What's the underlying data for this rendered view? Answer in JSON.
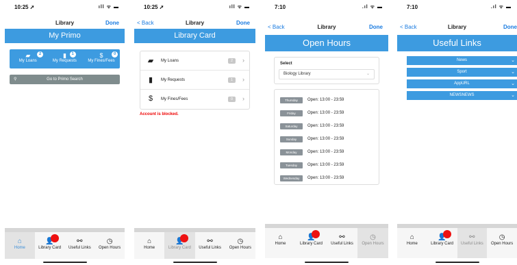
{
  "screens": [
    {
      "status": {
        "time": "10:25 ➚",
        "signal": "ıll ᯤ ▬"
      },
      "nav": {
        "back": "",
        "title": "Library",
        "done": "Done"
      },
      "banner": "My Primo",
      "summary": [
        {
          "icon": "book-icon",
          "glyph": "▰",
          "label": "My Loans",
          "count": "2"
        },
        {
          "icon": "bookmark-icon",
          "glyph": "▮",
          "label": "My Requests",
          "count": "1"
        },
        {
          "icon": "dollar-icon",
          "glyph": "$",
          "label": "My Fines/Fees",
          "count": "0"
        }
      ],
      "search": {
        "icon": "search-icon",
        "glyph": "⚲",
        "label": "Go to Primo Search"
      },
      "tabs": [
        {
          "icon": "home-icon",
          "glyph": "⌂",
          "label": "Home"
        },
        {
          "icon": "user-icon",
          "glyph": "👤",
          "label": "Library Card"
        },
        {
          "icon": "link-icon",
          "glyph": "⚯",
          "label": "Useful Links"
        },
        {
          "icon": "clock-icon",
          "glyph": "◷",
          "label": "Open Hours"
        }
      ]
    },
    {
      "status": {
        "time": "10:25 ➚",
        "signal": "ıll ᯤ ▬"
      },
      "nav": {
        "back": "< Back",
        "title": "Library",
        "done": "Done"
      },
      "banner": "Library Card",
      "rows": [
        {
          "icon": "book-icon",
          "glyph": "▰",
          "label": "My Loans",
          "count": "2"
        },
        {
          "icon": "bookmark-icon",
          "glyph": "▮",
          "label": "My Requests",
          "count": "1"
        },
        {
          "icon": "dollar-icon",
          "glyph": "$",
          "label": "My Fines/Fees",
          "count": "0"
        }
      ],
      "blocked": "Account is blocked.",
      "tabs": [
        {
          "icon": "home-icon",
          "glyph": "⌂",
          "label": "Home"
        },
        {
          "icon": "user-icon",
          "glyph": "👤",
          "label": "Library Card"
        },
        {
          "icon": "link-icon",
          "glyph": "⚯",
          "label": "Useful Links"
        },
        {
          "icon": "clock-icon",
          "glyph": "◷",
          "label": "Open Hours"
        }
      ]
    },
    {
      "status": {
        "time": "7:10",
        "signal": ".ıl ᯤ ▬"
      },
      "nav": {
        "back": "< Back",
        "title": "Library",
        "done": "Done"
      },
      "banner": "Open Hours",
      "select": {
        "label": "Select",
        "value": "Biology Library"
      },
      "hours": [
        {
          "day": "Thursday",
          "time": "Open: 13:00 - 23:59"
        },
        {
          "day": "Friday",
          "time": "Open: 13:00 - 23:59"
        },
        {
          "day": "Saturday",
          "time": "Open: 13:00 - 23:59"
        },
        {
          "day": "Sunday",
          "time": "Open: 13:00 - 23:59"
        },
        {
          "day": "Monday",
          "time": "Open: 13:00 - 23:59"
        },
        {
          "day": "Tuesday",
          "time": "Open: 13:00 - 23:59"
        },
        {
          "day": "Wednesday",
          "time": "Open: 13:00 - 23:59"
        }
      ],
      "tabs": [
        {
          "icon": "home-icon",
          "glyph": "⌂",
          "label": "Home"
        },
        {
          "icon": "user-icon",
          "glyph": "👤",
          "label": "Library Card"
        },
        {
          "icon": "link-icon",
          "glyph": "⚯",
          "label": "Useful Links"
        },
        {
          "icon": "clock-icon",
          "glyph": "◷",
          "label": "Open Hours"
        }
      ]
    },
    {
      "status": {
        "time": "7:10",
        "signal": ".ıl ᯤ ▬"
      },
      "nav": {
        "back": "< Back",
        "title": "Library",
        "done": "Done"
      },
      "banner": "Useful Links",
      "links": [
        {
          "label": "News"
        },
        {
          "label": "Sport"
        },
        {
          "label": "AppURL"
        },
        {
          "label": "NEWSNEWS"
        }
      ],
      "tabs": [
        {
          "icon": "home-icon",
          "glyph": "⌂",
          "label": "Home"
        },
        {
          "icon": "user-icon",
          "glyph": "👤",
          "label": "Library Card"
        },
        {
          "icon": "link-icon",
          "glyph": "⚯",
          "label": "Useful Links"
        },
        {
          "icon": "clock-icon",
          "glyph": "◷",
          "label": "Open Hours"
        }
      ]
    }
  ]
}
